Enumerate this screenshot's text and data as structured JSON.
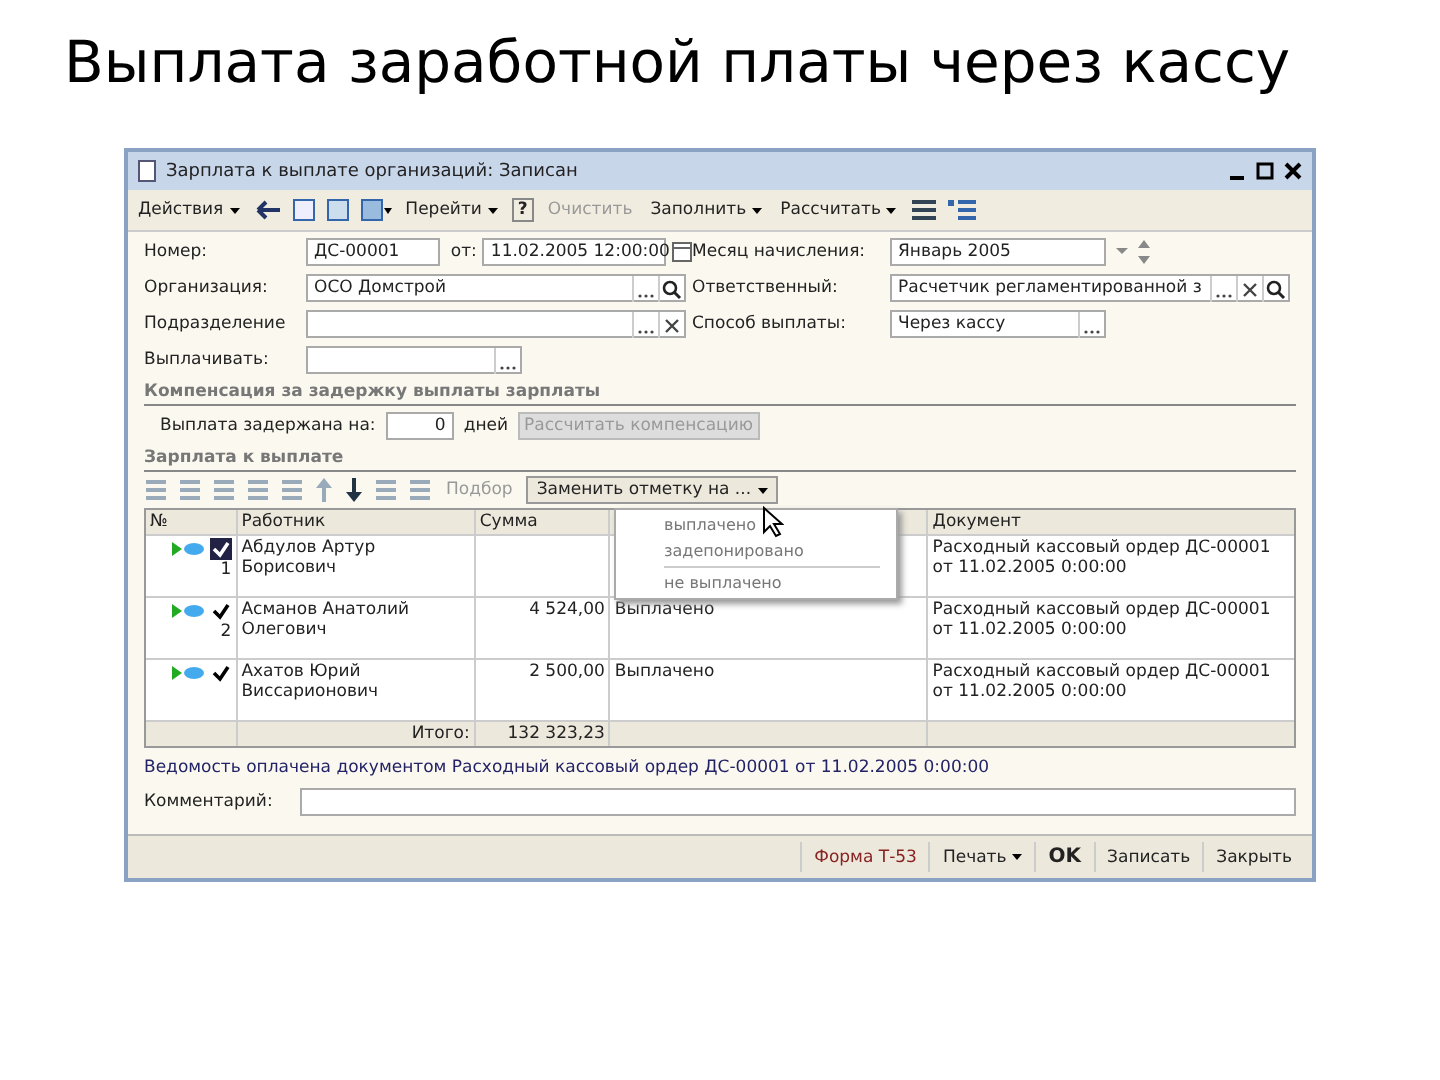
{
  "slide_title": "Выплата заработной платы через кассу",
  "window": {
    "title": "Зарплата к выплате организаций: Записан"
  },
  "toolbar": {
    "actions": "Действия",
    "goto": "Перейти",
    "help": "?",
    "clear": "Очистить",
    "fill": "Заполнить",
    "calc": "Рассчитать"
  },
  "fields": [
    {
      "label": "Номер:",
      "value": "ДС-00001",
      "kind": "number",
      "extra_label": "от:",
      "extra_value": "11.02.2005 12:00:00"
    },
    {
      "label": "Месяц начисления:",
      "value": "Январь 2005",
      "kind": "month"
    },
    {
      "label": "Организация:",
      "value": "ОСО Домстрой",
      "kind": "ref"
    },
    {
      "label": "Ответственный:",
      "value": "Расчетчик регламентированной з",
      "kind": "ref3"
    },
    {
      "label": "Подразделение",
      "kind": "ref"
    },
    {
      "label": "Способ выплаты:",
      "value": "Через кассу",
      "kind": "choice"
    },
    {
      "label": "Выплачивать:",
      "kind": "choice"
    }
  ],
  "compensation": {
    "heading": "Компенсация за задержку выплаты зарплаты",
    "label": "Выплата задержана на:",
    "days": "0",
    "unit": "дней",
    "button": "Рассчитать компенсацию"
  },
  "payroll": {
    "heading": "Зарплата к выплате",
    "pick": "Подбор",
    "replace": "Заменить отметку на ...",
    "menu": [
      {
        "label": "выплачено",
        "kind": "item"
      },
      {
        "label": "задепонировано",
        "kind": "item"
      },
      {
        "label": "не выплачено",
        "kind": "item",
        "separator_before": true
      }
    ],
    "columns": [
      "№",
      "Работник",
      "Сумма",
      "",
      "Документ"
    ],
    "rows": [
      {
        "number": "1",
        "employee": "Абдулов Артур Борисович",
        "selected": true,
        "checked": true,
        "document": "Расходный кассовый ордер ДС-00001 от 11.02.2005 0:00:00"
      },
      {
        "number": "2",
        "employee": "Асманов Анатолий Олегович",
        "selected": false,
        "checked": true,
        "sum": "4 524,00",
        "status": "Выплачено",
        "document": "Расходный кассовый ордер ДС-00001 от 11.02.2005 0:00:00"
      },
      {
        "employee": "Ахатов Юрий Виссарионович",
        "selected": false,
        "checked": true,
        "sum": "2 500,00",
        "status": "Выплачено",
        "document": "Расходный кассовый ордер ДС-00001 от 11.02.2005 0:00:00"
      }
    ],
    "total_label": "Итого:",
    "total": "132 323,23"
  },
  "note": "Ведомость оплачена документом Расходный кассовый ордер ДС-00001 от 11.02.2005 0:00:00",
  "comment_label": "Комментарий:",
  "footer": {
    "form": "Форма Т-53",
    "print": "Печать",
    "ok": "OK",
    "save": "Записать",
    "close": "Закрыть"
  }
}
